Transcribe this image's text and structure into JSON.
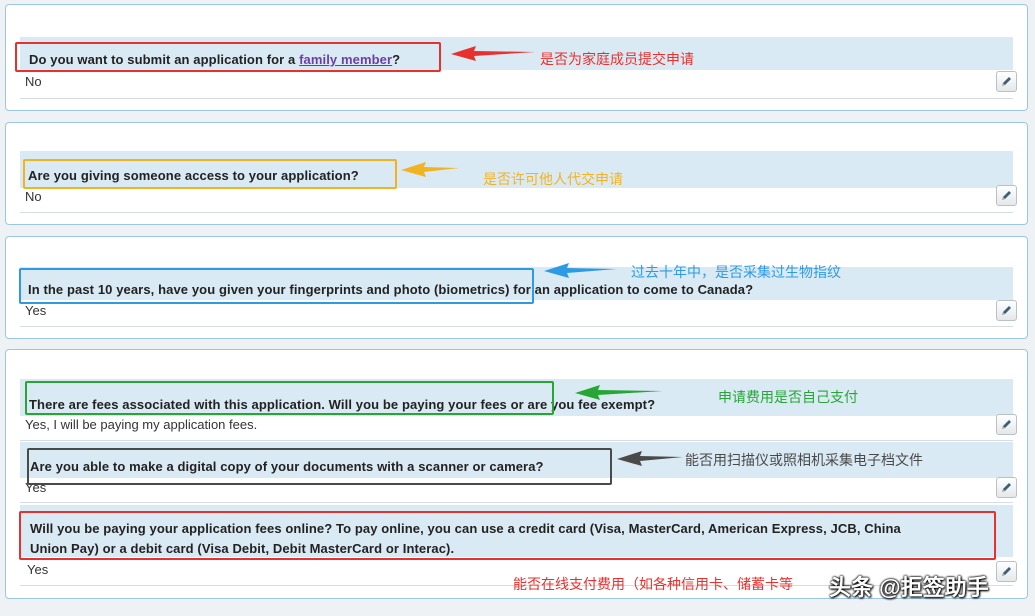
{
  "questions": [
    {
      "question_prefix": "Do you want to submit an application for a ",
      "question_link": "family member",
      "question_suffix": "?",
      "answer": "No",
      "note": "是否为家庭成员提交申请",
      "color": "#e8302e"
    },
    {
      "question": "Are you giving someone access to your application?",
      "answer": "No",
      "note": "是否许可他人代交申请",
      "color": "#f2b322"
    },
    {
      "question": "In the past 10 years, have you given your fingerprints and photo (biometrics) for an application to come to Canada?",
      "answer": "Yes",
      "note": "过去十年中，是否采集过生物指纹",
      "color": "#2d9be4"
    },
    {
      "question": "There are fees associated with this application. Will you be paying your fees or are you fee exempt?",
      "answer": "Yes, I will be paying my application fees.",
      "note": "申请费用是否自己支付",
      "color": "#27a636"
    },
    {
      "question": "Are you able to make a digital copy of your documents with a scanner or camera?",
      "answer": "Yes",
      "note": "能否用扫描仪或照相机采集电子档文件",
      "color": "#4a4a4a"
    },
    {
      "question_line1": "Will you be paying your application fees online?  To pay online, you can use a credit card (Visa, MasterCard, American Express, JCB, China",
      "question_line2": "Union Pay) or a debit card (Visa Debit, Debit MasterCard or Interac).",
      "answer": "Yes",
      "note": "能否在线支付费用（如各种信用卡、储蓄卡等",
      "color": "#e8302e"
    }
  ],
  "watermark": "头条 @拒签助手"
}
